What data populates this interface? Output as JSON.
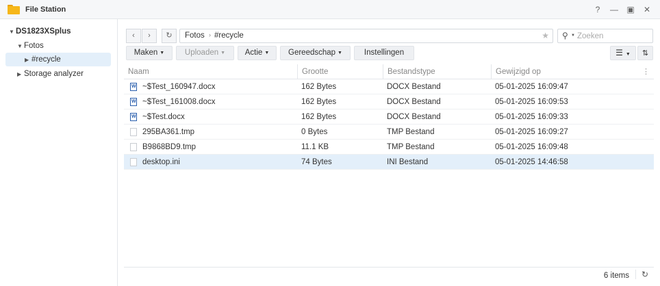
{
  "window": {
    "title": "File Station",
    "controls": {
      "help": "?",
      "minimize": "—",
      "maximize": "▣",
      "close": "✕"
    }
  },
  "sidebar": {
    "root": "DS1823XSplus",
    "items": [
      {
        "label": "Fotos"
      },
      {
        "label": "#recycle"
      },
      {
        "label": "Storage analyzer"
      }
    ]
  },
  "nav": {
    "back": "‹",
    "forward": "›",
    "refresh": "↻"
  },
  "path": {
    "segments": [
      "Fotos",
      "#recycle"
    ],
    "separator": "›",
    "favorite": "★"
  },
  "search": {
    "placeholder": "Zoeken"
  },
  "toolbar": {
    "maken": "Maken",
    "uploaden": "Uploaden",
    "actie": "Actie",
    "gereedschap": "Gereedschap",
    "instellingen": "Instellingen"
  },
  "table": {
    "columns": [
      "Naam",
      "Grootte",
      "Bestandstype",
      "Gewijzigd op"
    ],
    "rows": [
      {
        "name": "~$Test_160947.docx",
        "size": "162 Bytes",
        "type": "DOCX Bestand",
        "modified": "05-01-2025 16:09:47",
        "icon": "docx"
      },
      {
        "name": "~$Test_161008.docx",
        "size": "162 Bytes",
        "type": "DOCX Bestand",
        "modified": "05-01-2025 16:09:53",
        "icon": "docx"
      },
      {
        "name": "~$Test.docx",
        "size": "162 Bytes",
        "type": "DOCX Bestand",
        "modified": "05-01-2025 16:09:33",
        "icon": "docx"
      },
      {
        "name": "295BA361.tmp",
        "size": "0 Bytes",
        "type": "TMP Bestand",
        "modified": "05-01-2025 16:09:27",
        "icon": "file"
      },
      {
        "name": "B9868BD9.tmp",
        "size": "11.1 KB",
        "type": "TMP Bestand",
        "modified": "05-01-2025 16:09:48",
        "icon": "file"
      },
      {
        "name": "desktop.ini",
        "size": "74 Bytes",
        "type": "INI Bestand",
        "modified": "05-01-2025 14:46:58",
        "icon": "file"
      }
    ]
  },
  "footer": {
    "count": "6 items"
  },
  "colors": {
    "selection": "#e3effa",
    "folder": "#f6b71a",
    "word": "#2b5fad"
  }
}
